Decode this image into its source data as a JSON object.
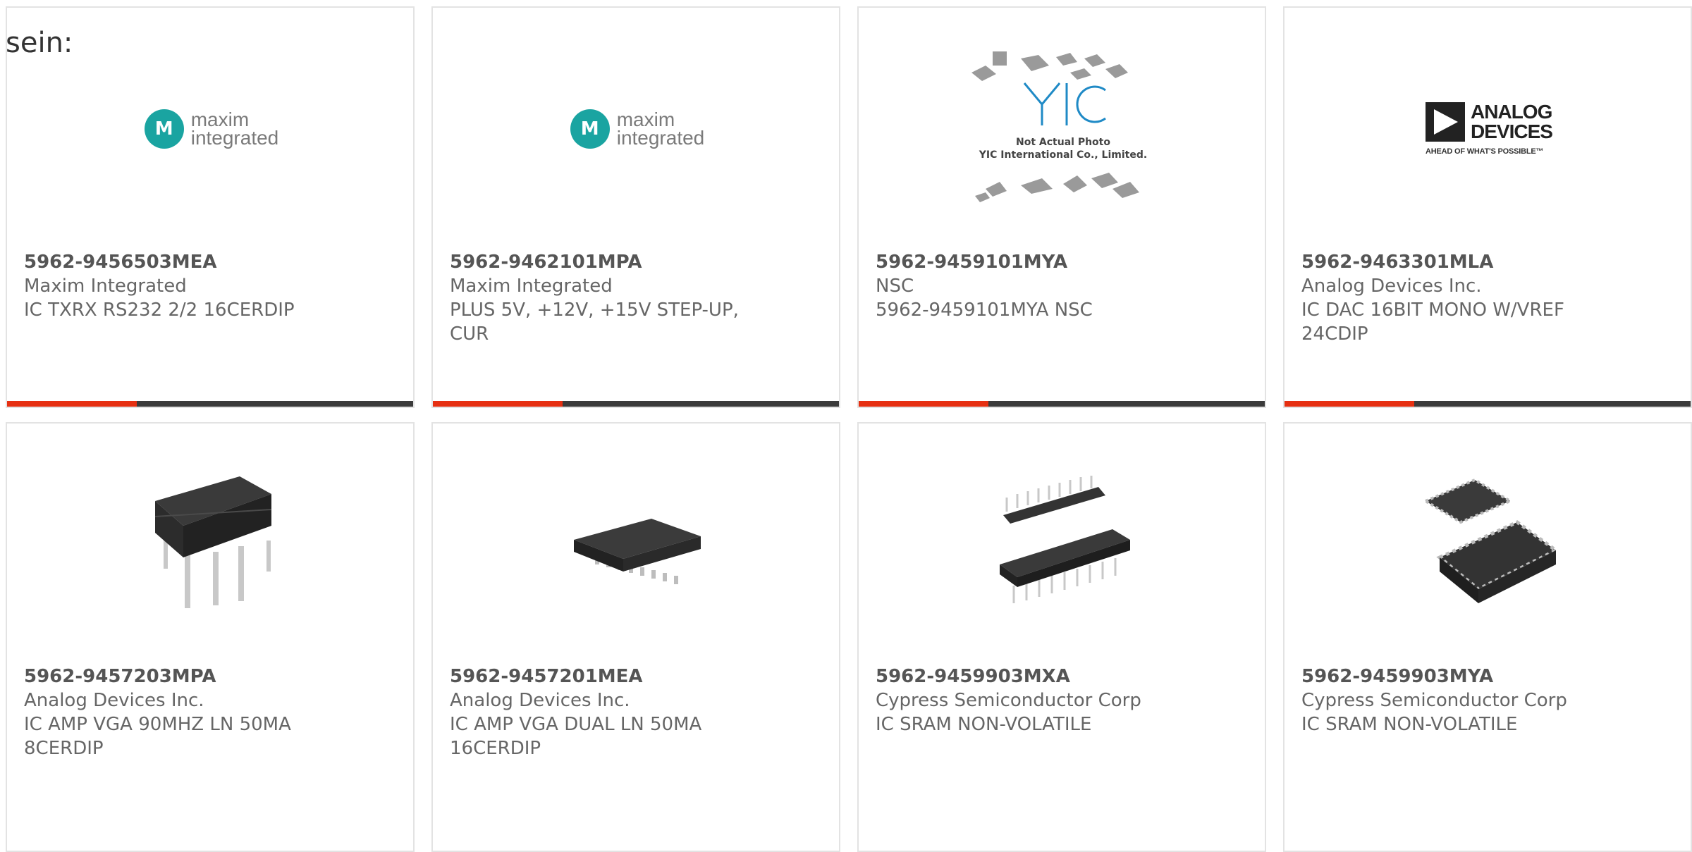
{
  "page": {
    "fragment": "sein:"
  },
  "products": [
    {
      "part": "5962-9456503MEA",
      "manufacturer": "Maxim Integrated",
      "description": "IC TXRX RS232 2/2 16CERDIP",
      "image": "maxim-logo",
      "logo_text": [
        "maxim",
        "integrated"
      ]
    },
    {
      "part": "5962-9462101MPA",
      "manufacturer": "Maxim Integrated",
      "description": "PLUS 5V, +12V, +15V STEP-UP, CUR",
      "image": "maxim-logo",
      "logo_text": [
        "maxim",
        "integrated"
      ]
    },
    {
      "part": "5962-9459101MYA",
      "manufacturer": "NSC",
      "description": "5962-9459101MYA NSC",
      "image": "yic-placeholder",
      "logo_text": [
        "Not Actual Photo",
        "YIC International Co., Limited."
      ]
    },
    {
      "part": "5962-9463301MLA",
      "manufacturer": "Analog Devices Inc.",
      "description": "IC DAC 16BIT MONO W/VREF 24CDIP",
      "image": "adi-logo",
      "logo_text": [
        "ANALOG",
        "DEVICES",
        "AHEAD OF WHAT'S POSSIBLE™"
      ]
    },
    {
      "part": "5962-9457203MPA",
      "manufacturer": "Analog Devices Inc.",
      "description": "IC AMP VGA 90MHZ LN 50MA 8CERDIP",
      "image": "cerdip-8-chip"
    },
    {
      "part": "5962-9457201MEA",
      "manufacturer": "Analog Devices Inc.",
      "description": "IC AMP VGA DUAL LN 50MA 16CERDIP",
      "image": "soic-16-chip"
    },
    {
      "part": "5962-9459903MXA",
      "manufacturer": "Cypress Semiconductor Corp",
      "description": "IC SRAM NON-VOLATILE",
      "image": "dip-28-chip"
    },
    {
      "part": "5962-9459903MYA",
      "manufacturer": "Cypress Semiconductor Corp",
      "description": "IC SRAM NON-VOLATILE",
      "image": "lcc-chip"
    }
  ],
  "colors": {
    "accent": "#e63012",
    "bar": "#3b3b3b",
    "border": "#e3e3e3",
    "maxim_teal": "#1aa4a1"
  }
}
